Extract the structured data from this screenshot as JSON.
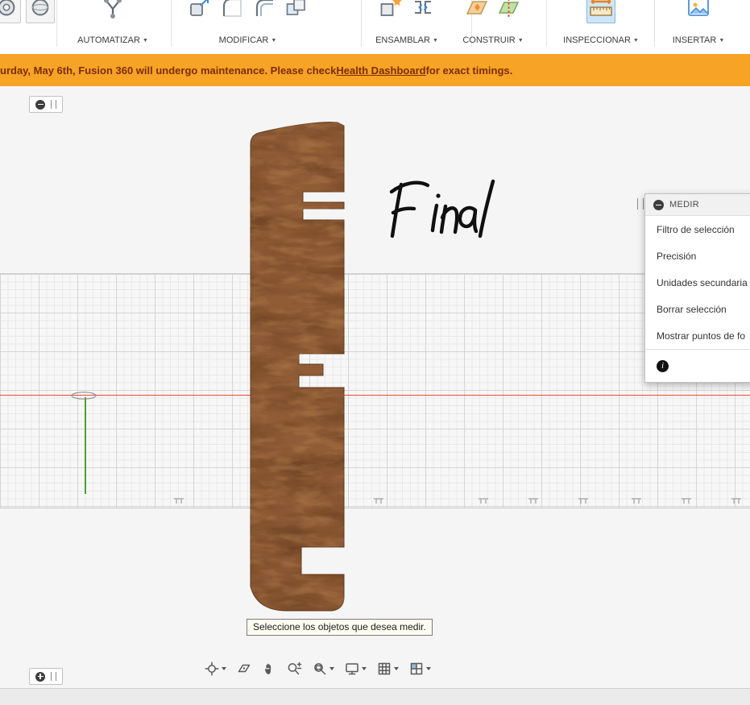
{
  "toolbar": {
    "caret": "▼",
    "groups": [
      {
        "label": "AUTOMATIZAR"
      },
      {
        "label": "MODIFICAR"
      },
      {
        "label": "ENSAMBLAR"
      },
      {
        "label": "CONSTRUIR"
      },
      {
        "label": "INSPECCIONAR"
      },
      {
        "label": "INSERTAR"
      }
    ]
  },
  "banner": {
    "prefix": "urday, May 6th, Fusion 360 will undergo maintenance. Please check ",
    "link_text": "Health Dashboard",
    "suffix": " for exact timings.",
    "bg_color": "#F6A326",
    "text_color": "#7D2D00"
  },
  "canvas": {
    "annotation_text": "Final",
    "axis_x_color": "#E8473C",
    "axis_y_color": "#4F9E31",
    "wood_color": "#8F5B36"
  },
  "measure_panel": {
    "title": "MEDIR",
    "items": [
      "Filtro de selección",
      "Precisión",
      "Unidades secundaria",
      "Borrar selección",
      "Mostrar puntos de fo"
    ],
    "info_glyph": "i"
  },
  "tooltip": {
    "text": "Seleccione los objetos que desea medir."
  },
  "nav_bar": {
    "icons": [
      "orbit",
      "look-at",
      "pan",
      "zoom",
      "fit-view",
      "display-settings",
      "grid-settings",
      "viewports"
    ]
  }
}
